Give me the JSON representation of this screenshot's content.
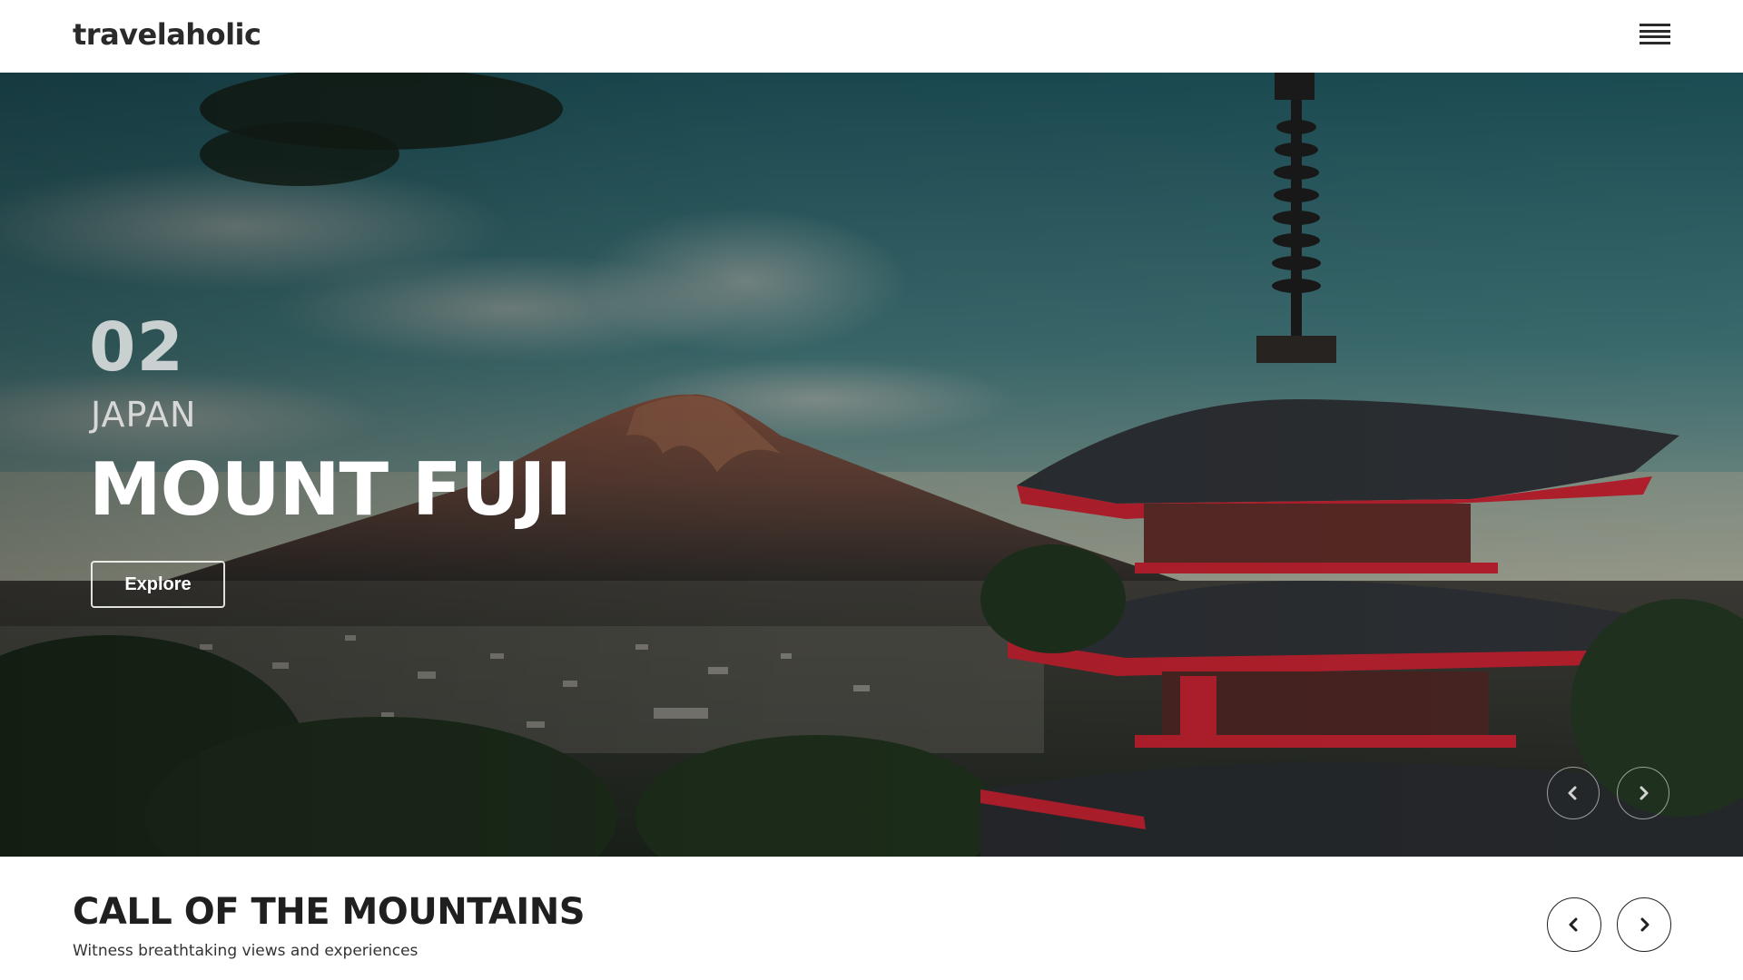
{
  "header": {
    "brand": "travelaholic",
    "menu_icon": "hamburger-menu-icon"
  },
  "hero": {
    "slide_number": "02",
    "country": "JAPAN",
    "title": "MOUNT FUJI",
    "cta_label": "Explore",
    "prev_icon": "chevron-left-icon",
    "next_icon": "chevron-right-icon"
  },
  "section": {
    "title": "CALL OF THE MOUNTAINS",
    "subtitle": "Witness breathtaking views and experiences",
    "prev_icon": "chevron-left-icon",
    "next_icon": "chevron-right-icon"
  },
  "colors": {
    "text_dark": "#1f1f1f",
    "background": "#ffffff",
    "pagoda_red": "#b8202e",
    "sky_teal": "#2f6a70"
  }
}
